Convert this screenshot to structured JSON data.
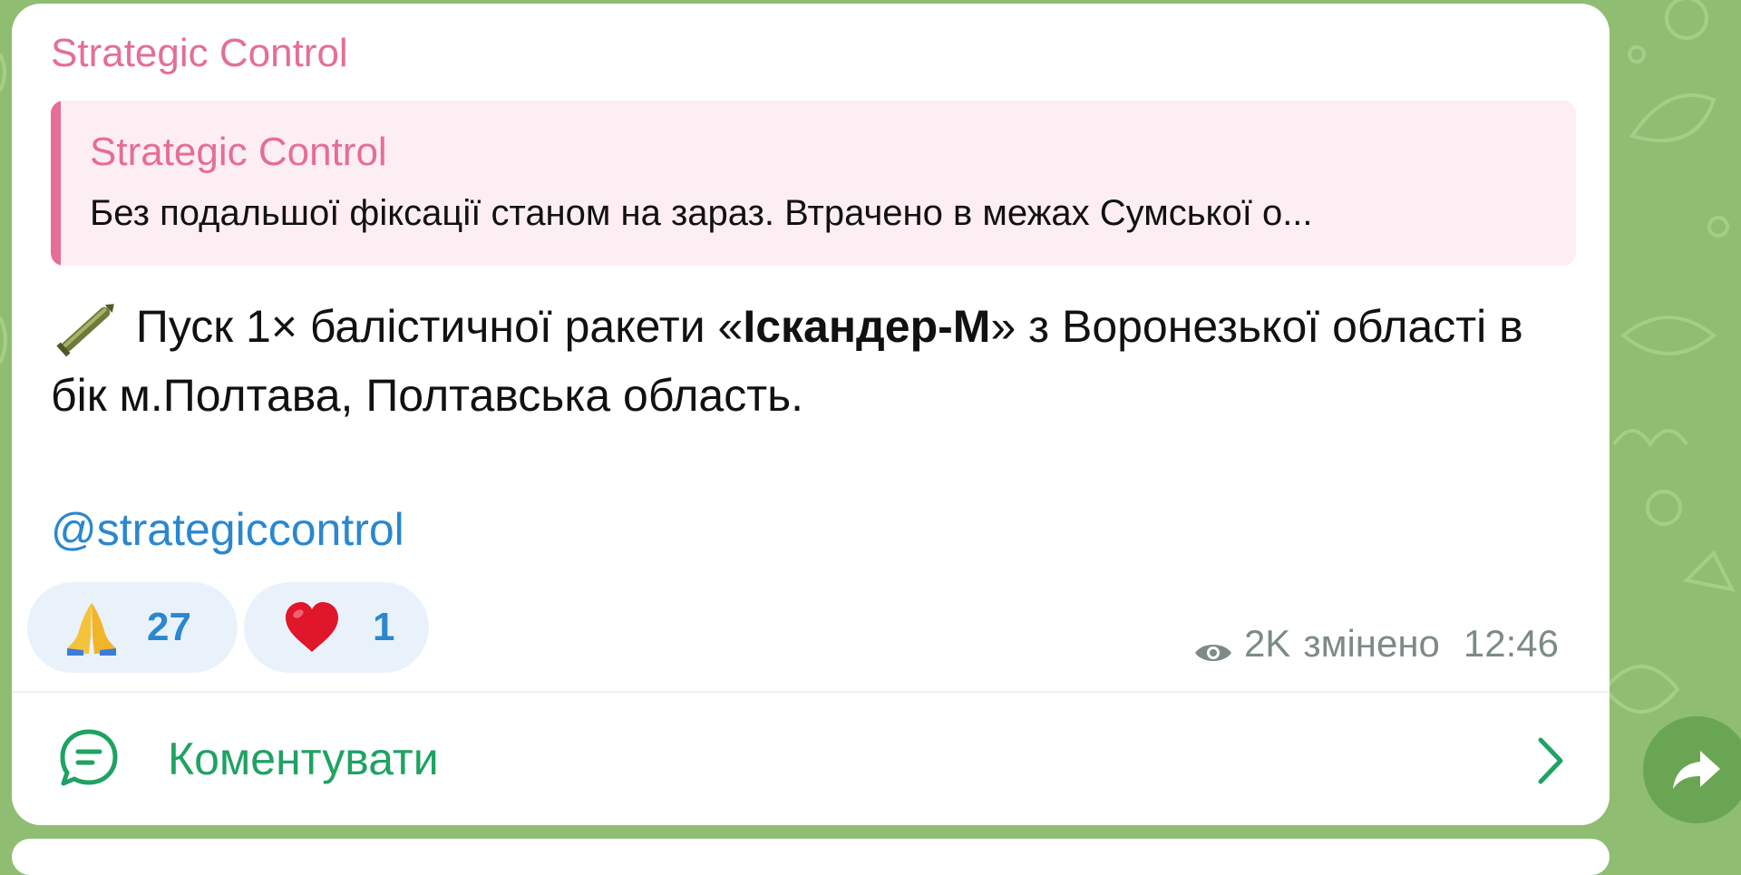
{
  "message": {
    "channel_name": "Strategic Control",
    "reply": {
      "sender": "Strategic Control",
      "text": "Без подальшої фіксації станом на зараз. Втрачено в межах Сумської о..."
    },
    "text_before": " Пуск 1× балістичної ракети «",
    "text_bold": "Іскандер-М",
    "text_after": "» з Воронезької області в бік м.Полтава, Полтавська область.",
    "mention": "@strategiccontrol",
    "reactions": [
      {
        "icon": "praying-hands-icon",
        "count": "27"
      },
      {
        "icon": "red-heart-icon",
        "count": "1"
      }
    ],
    "views": "2K",
    "edited_label": "змінено",
    "time": "12:46",
    "comment_label": "Коментувати"
  },
  "colors": {
    "accent_name": "#e56e95",
    "link": "#2a87d0",
    "comment": "#1fa262",
    "wallpaper": "#8fbd72"
  }
}
